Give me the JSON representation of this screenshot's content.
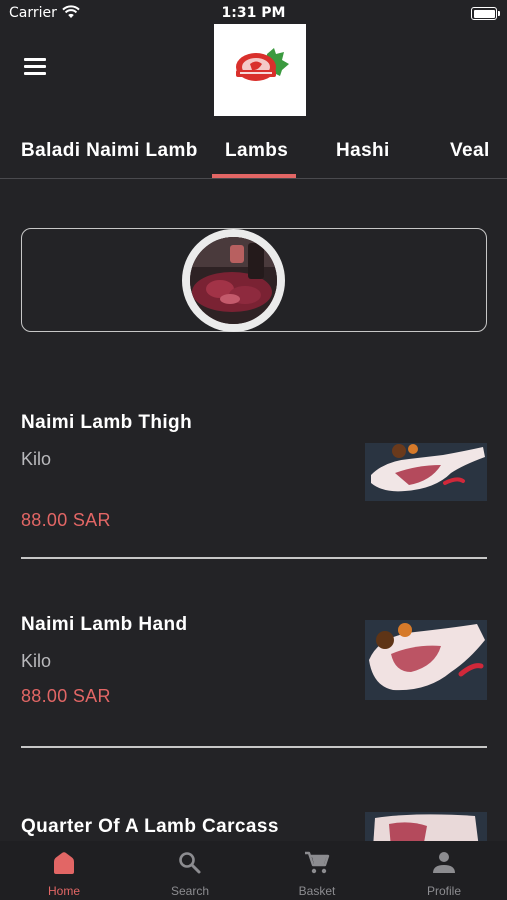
{
  "status_bar": {
    "carrier": "Carrier",
    "time": "1:31 PM"
  },
  "tabs": [
    "Baladi Naimi Lamb",
    "Lambs",
    "Hashi",
    "Veal"
  ],
  "active_tab": "Lambs",
  "products": [
    {
      "name": "Naimi Lamb Thigh",
      "unit": "Kilo",
      "price": "88.00 SAR"
    },
    {
      "name": "Naimi Lamb Hand",
      "unit": "Kilo",
      "price": "88.00 SAR"
    },
    {
      "name": "Quarter Of A Lamb Carcass",
      "unit": "",
      "price": ""
    }
  ],
  "bottom_nav": [
    {
      "label": "Home",
      "icon": "home-icon",
      "active": true
    },
    {
      "label": "Search",
      "icon": "search-icon",
      "active": false
    },
    {
      "label": "Basket",
      "icon": "cart-icon",
      "active": false
    },
    {
      "label": "Profile",
      "icon": "person-icon",
      "active": false
    }
  ],
  "colors": {
    "background": "#232326",
    "accent": "#e26665",
    "nav_background": "#1f1f22"
  }
}
